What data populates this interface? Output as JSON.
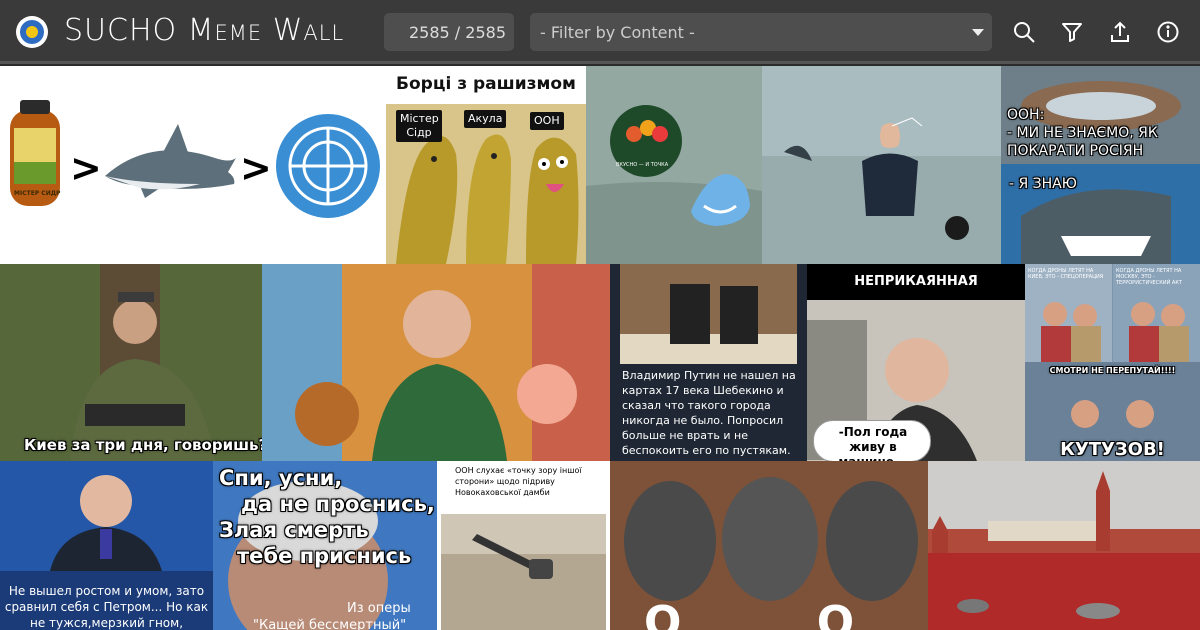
{
  "app": {
    "title": "SUCHO Meme Wall",
    "counter": "2585 / 2585",
    "filter_placeholder": "- Filter by Content -",
    "icons": [
      "search-icon",
      "filter-icon",
      "upload-icon",
      "info-icon"
    ]
  },
  "colors": {
    "header_bg": "#3a3a3a",
    "field_bg": "#4e4e4e",
    "logo_blue": "#2d6cc0",
    "logo_yellow": "#f3c614"
  },
  "memes": {
    "m1": {
      "label": "МІСТЕР СИДР",
      "gt1": ">",
      "gt2": ">"
    },
    "m2": {
      "title": "Борці з рашизмом",
      "labels": [
        "Містер Сідр",
        "Акула",
        "ООН"
      ]
    },
    "m3": {
      "badge": "ВКУСНО — И ТОЧКА"
    },
    "m5": {
      "top": "ООН:\n- МИ НЕ ЗНАЄМО, ЯК ПОКАРАТИ РОСІЯН",
      "bottom": "- Я ЗНАЮ"
    },
    "m6": {
      "caption": "Киев за три дня, говоришь?"
    },
    "m8": {
      "caption": "Владимир Путин не нашел на картах 17 века Шебекино и сказал что такого города никогда не было. Попросил больше не врать и не беспокоить его по пустякам."
    },
    "m9": {
      "title": "НЕПРИКАЯННАЯ",
      "bubble": "-Пол года живу в машине..."
    },
    "m10": {
      "top_left": "КОГДА ДРОНЫ ЛЕТЯТ НА КИЕВ, ЭТО - СПЕЦОПЕРАЦИЯ",
      "top_right": "КОГДА ДРОНЫ ЛЕТЯТ НА МОСКВУ, ЭТО - ТЕРРОРИСТИЧЕСКИЙ АКТ",
      "middle": "СМОТРИ НЕ ПЕРЕПУТАЙ!!!!",
      "bottom": "КУТУЗОВ!"
    },
    "m11": {
      "caption": "Не вышел ростом и умом, зато сравнил себя с Петром... Но как не тужся,мерзкий гном,"
    },
    "m12": {
      "line1": "Спи, усни,",
      "line2": "да не проснись,",
      "line3": "Злая смерть",
      "line4": "тебе приснись",
      "source1": "Из оперы",
      "source2": "\"Кащей бессмертный\""
    },
    "m13": {
      "caption": "ООН слухає «точку зору іншої сторони» щодо підриву Новокаховської дамби"
    },
    "m14": {
      "letters": "О О Н"
    }
  }
}
